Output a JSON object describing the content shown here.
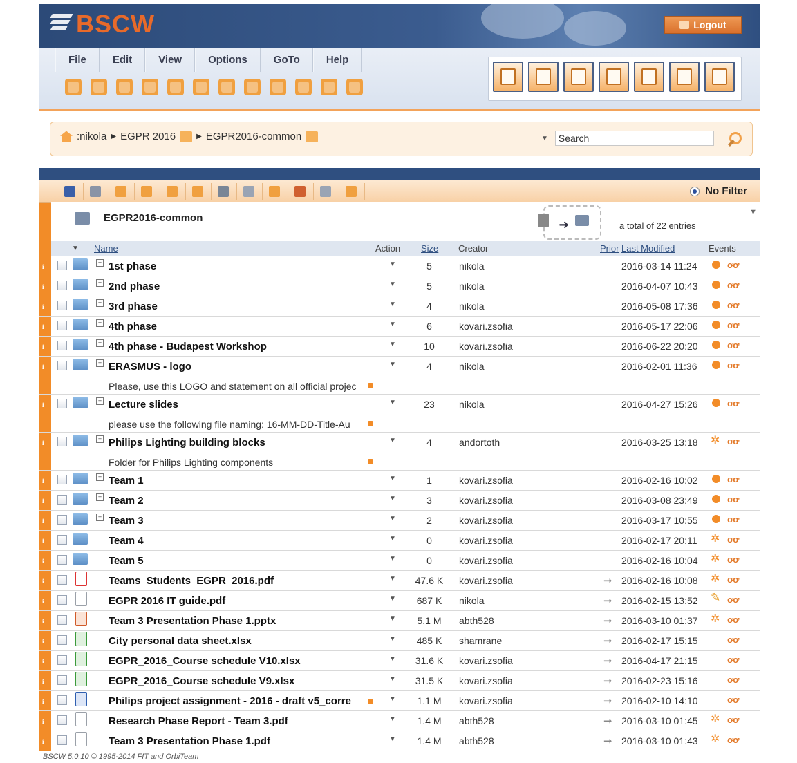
{
  "app": {
    "logo_text": "BSCW",
    "logout_label": "Logout",
    "brand_color": "#e86a2a",
    "header_color": "#2f4f80",
    "accent_color": "#f28c28"
  },
  "menu": [
    "File",
    "Edit",
    "View",
    "Options",
    "GoTo",
    "Help"
  ],
  "toolbar_icons": [
    {
      "name": "open-folder-icon",
      "color": "#f0a040"
    },
    {
      "name": "book-icon",
      "color": "#f0a040"
    },
    {
      "name": "pencil-icon",
      "color": "#f0a040"
    },
    {
      "name": "add-user-icon",
      "color": "#f0a040"
    },
    {
      "name": "new-folder-icon",
      "color": "#f0a040"
    },
    {
      "name": "new-document-icon",
      "color": "#f0a040"
    },
    {
      "name": "add-group-icon",
      "color": "#f0a040"
    },
    {
      "name": "add-comment-icon",
      "color": "#f0a040"
    },
    {
      "name": "export-icon",
      "color": "#f0a040"
    },
    {
      "name": "send-document-icon",
      "color": "#f0a040"
    },
    {
      "name": "mail-icon",
      "color": "#f0a040"
    },
    {
      "name": "note-icon",
      "color": "#f0a040"
    }
  ],
  "nav_icons": [
    "home-icon",
    "community-icon",
    "clipboard-icon",
    "trash-icon",
    "bookmarks-icon",
    "calendar-icon",
    "addressbook-icon"
  ],
  "breadcrumb": {
    "items": [
      ":nikola",
      "EGPR 2016",
      "EGPR2016-common"
    ]
  },
  "search": {
    "value": "Search"
  },
  "list_toolbar": {
    "icons": [
      "select-all-icon",
      "deselect-icon",
      "expand-all-icon",
      "collapse-all-icon",
      "tools-icon",
      "edit-folder-icon",
      "cut-icon",
      "copy-icon",
      "paste-icon",
      "delete-icon",
      "zip-icon",
      "properties-icon"
    ],
    "filter_label": "No Filter"
  },
  "folder": {
    "name": "EGPR2016-common",
    "total": "a total of 22 entries"
  },
  "columns": {
    "name": "Name",
    "action": "Action",
    "size": "Size",
    "creator": "Creator",
    "prior": "Prior",
    "last_modified": "Last Modified",
    "events": "Events"
  },
  "rows": [
    {
      "type": "folder",
      "expand": true,
      "name": "1st phase",
      "size": "5",
      "creator": "nikola",
      "modified": "2016-03-14 11:24",
      "event": "dot"
    },
    {
      "type": "folder",
      "expand": true,
      "name": "2nd phase",
      "size": "5",
      "creator": "nikola",
      "modified": "2016-04-07 10:43",
      "event": "dot"
    },
    {
      "type": "folder",
      "expand": true,
      "name": "3rd phase",
      "size": "4",
      "creator": "nikola",
      "modified": "2016-05-08 17:36",
      "event": "dot"
    },
    {
      "type": "folder",
      "expand": true,
      "name": "4th phase",
      "size": "6",
      "creator": "kovari.zsofia",
      "modified": "2016-05-17 22:06",
      "event": "dot"
    },
    {
      "type": "folder",
      "expand": true,
      "name": "4th phase - Budapest Workshop",
      "size": "10",
      "creator": "kovari.zsofia",
      "modified": "2016-06-22 20:20",
      "event": "dot"
    },
    {
      "type": "folder",
      "expand": true,
      "name": "ERASMUS - logo",
      "desc": "Please, use this LOGO and statement on all official projec",
      "size": "4",
      "creator": "nikola",
      "modified": "2016-02-01 11:36",
      "event": "dot"
    },
    {
      "type": "folder",
      "expand": true,
      "name": "Lecture slides",
      "desc": "please use the following file naming: 16-MM-DD-Title-Au",
      "size": "23",
      "creator": "nikola",
      "modified": "2016-04-27 15:26",
      "event": "dot"
    },
    {
      "type": "folder",
      "expand": true,
      "name": "Philips Lighting building blocks",
      "desc": "Folder for Philips Lighting components",
      "size": "4",
      "creator": "andortoth",
      "modified": "2016-03-25 13:18",
      "event": "star"
    },
    {
      "type": "folder",
      "expand": true,
      "name": "Team 1",
      "size": "1",
      "creator": "kovari.zsofia",
      "modified": "2016-02-16 10:02",
      "event": "dot"
    },
    {
      "type": "folder",
      "expand": true,
      "name": "Team 2",
      "size": "3",
      "creator": "kovari.zsofia",
      "modified": "2016-03-08 23:49",
      "event": "dot"
    },
    {
      "type": "folder",
      "expand": true,
      "name": "Team 3",
      "size": "2",
      "creator": "kovari.zsofia",
      "modified": "2016-03-17 10:55",
      "event": "dot"
    },
    {
      "type": "folder",
      "expand": false,
      "name": "Team 4",
      "size": "0",
      "creator": "kovari.zsofia",
      "modified": "2016-02-17 20:11",
      "event": "star"
    },
    {
      "type": "folder",
      "expand": false,
      "name": "Team 5",
      "size": "0",
      "creator": "kovari.zsofia",
      "modified": "2016-02-16 10:04",
      "event": "star"
    },
    {
      "type": "pdf",
      "expand": false,
      "name": "Teams_Students_EGPR_2016.pdf",
      "size": "47.6 K",
      "creator": "kovari.zsofia",
      "modified": "2016-02-16 10:08",
      "event": "star",
      "arrow": true
    },
    {
      "type": "doc",
      "expand": false,
      "name": "EGPR 2016 IT guide.pdf",
      "size": "687 K",
      "creator": "nikola",
      "modified": "2016-02-15 13:52",
      "event": "pen",
      "arrow": true
    },
    {
      "type": "pptx",
      "expand": false,
      "name": "Team 3 Presentation Phase 1.pptx",
      "size": "5.1 M",
      "creator": "abth528",
      "modified": "2016-03-10 01:37",
      "event": "star",
      "arrow": true
    },
    {
      "type": "xlsx",
      "expand": false,
      "name": "City personal data sheet.xlsx",
      "size": "485 K",
      "creator": "shamrane",
      "modified": "2016-02-17 15:15",
      "event": "none",
      "arrow": true
    },
    {
      "type": "xlsx",
      "expand": false,
      "name": "EGPR_2016_Course schedule V10.xlsx",
      "size": "31.6 K",
      "creator": "kovari.zsofia",
      "modified": "2016-04-17 21:15",
      "event": "none",
      "arrow": true
    },
    {
      "type": "xlsx",
      "expand": false,
      "name": "EGPR_2016_Course schedule V9.xlsx",
      "size": "31.5 K",
      "creator": "kovari.zsofia",
      "modified": "2016-02-23 15:16",
      "event": "none",
      "arrow": true
    },
    {
      "type": "docx",
      "expand": false,
      "name": "Philips project assignment - 2016 - draft v5_corre",
      "size": "1.1 M",
      "creator": "kovari.zsofia",
      "modified": "2016-02-10 14:10",
      "event": "none",
      "arrow": true,
      "truncated": true
    },
    {
      "type": "doc",
      "expand": false,
      "name": "Research Phase Report - Team 3.pdf",
      "size": "1.4 M",
      "creator": "abth528",
      "modified": "2016-03-10 01:45",
      "event": "star",
      "arrow": true
    },
    {
      "type": "doc",
      "expand": false,
      "name": "Team 3 Presentation Phase 1.pdf",
      "size": "1.4 M",
      "creator": "abth528",
      "modified": "2016-03-10 01:43",
      "event": "star",
      "arrow": true
    }
  ],
  "footer": "BSCW 5.0.10 © 1995-2014 FIT and OrbiTeam"
}
